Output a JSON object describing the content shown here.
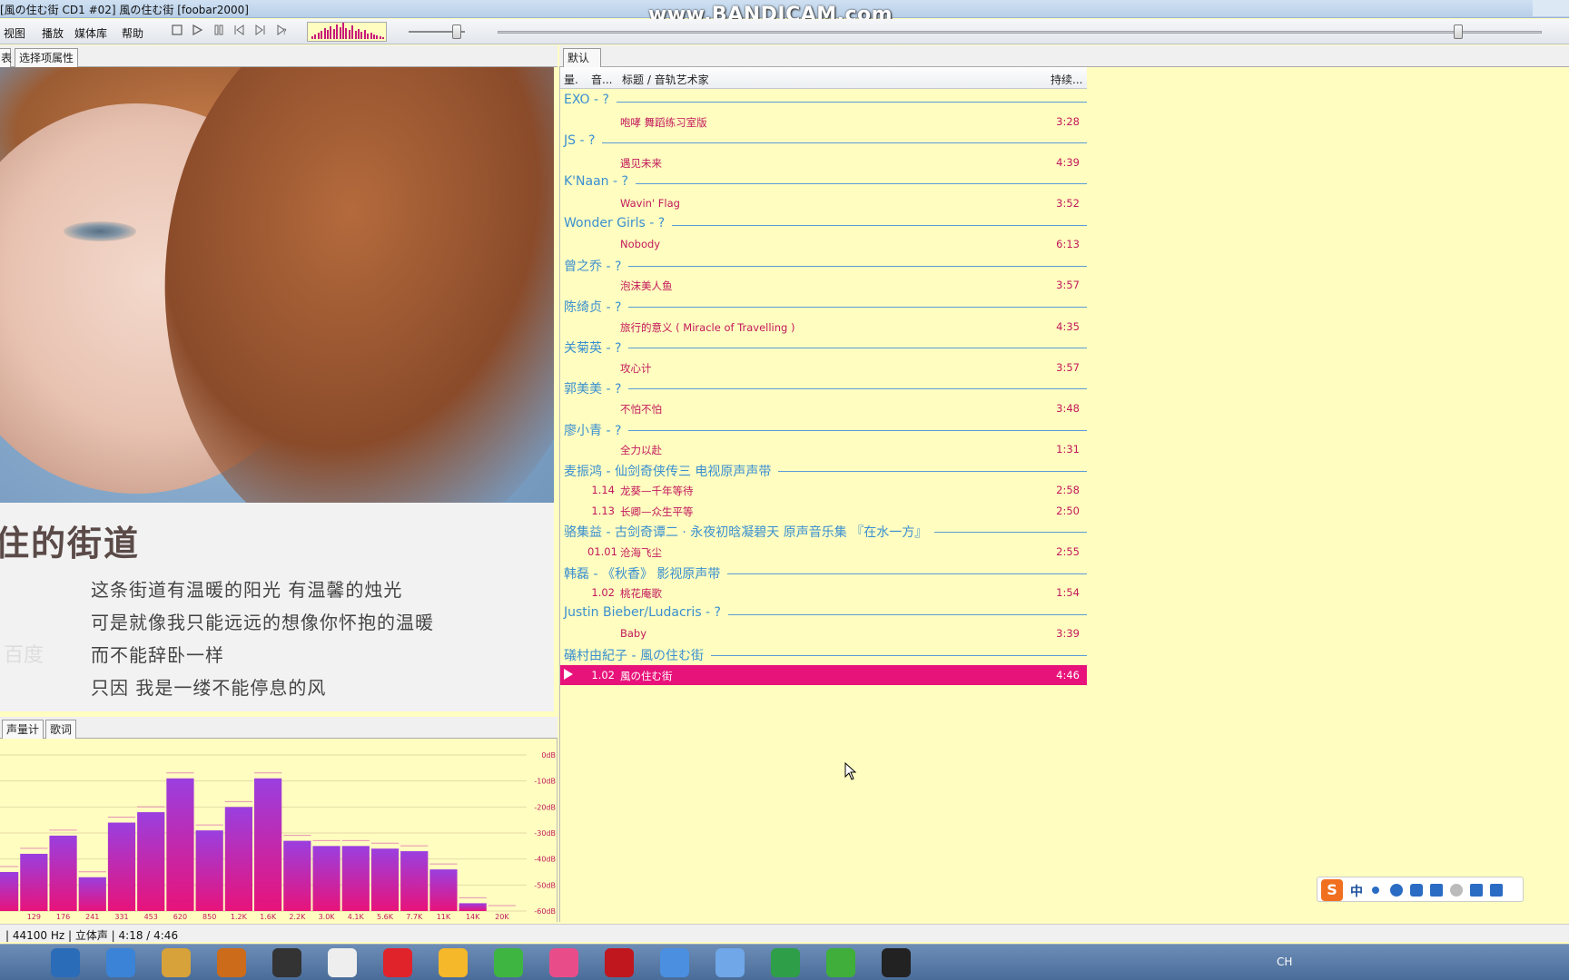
{
  "window": {
    "title": "[風の住む街 CD1 #02] 風の住む街  [foobar2000]",
    "watermark": "www.BANDICAM.com"
  },
  "menu": {
    "items": [
      "视图",
      "播放",
      "媒体库",
      "帮助"
    ]
  },
  "toolbar": {
    "buttons": [
      "stop-icon",
      "play-icon",
      "pause-icon",
      "prev-icon",
      "next-icon",
      "random-icon"
    ],
    "volume_level": 0.85,
    "seek_position": 0.92
  },
  "left_tabs": {
    "tab1": "表",
    "tab2": "选择项属性"
  },
  "lyrics": {
    "title": "住的街道",
    "lines": [
      "这条街道有温暖的阳光  有温馨的烛光",
      "可是就像我只能远远的想像你怀抱的温暖",
      "而不能辞卧一样",
      "只因  我是一缕不能停息的风"
    ],
    "logo": "百度"
  },
  "vis_tabs": {
    "tab1": "声量计",
    "tab2": "歌词"
  },
  "chart_data": {
    "type": "bar",
    "categories": [
      "",
      "129",
      "176",
      "241",
      "331",
      "453",
      "620",
      "850",
      "1.2K",
      "1.6K",
      "2.2K",
      "3.0K",
      "4.1K",
      "5.6K",
      "7.7K",
      "11K",
      "14K",
      "20K"
    ],
    "values": [
      -45,
      -38,
      -31,
      -47,
      -26,
      -22,
      -9,
      -29,
      -20,
      -9,
      -33,
      -35,
      -35,
      -36,
      -37,
      -44,
      -57,
      -60
    ],
    "ylim": [
      -60,
      0
    ],
    "yticks": [
      "0dB",
      "-10dB",
      "-20dB",
      "-30dB",
      "-40dB",
      "-50dB",
      "-60dB"
    ],
    "color_top": "#9a3fe0",
    "color_bottom": "#e8137a",
    "grid": true
  },
  "right_tabs": {
    "tab1": "默认"
  },
  "playlist": {
    "headers": {
      "col1": "量.",
      "col2": "音...",
      "col3": "标题 / 音轨艺术家",
      "col4": "持续..."
    },
    "groups": [
      {
        "label": "EXO - ?",
        "tracks": [
          {
            "num": "",
            "title": "咆哮 舞蹈练习室版",
            "dur": "3:28"
          }
        ]
      },
      {
        "label": "JS - ?",
        "tracks": [
          {
            "num": "",
            "title": "遇见未来",
            "dur": "4:39"
          }
        ]
      },
      {
        "label": "K'Naan - ?",
        "tracks": [
          {
            "num": "",
            "title": "Wavin' Flag",
            "dur": "3:52"
          }
        ]
      },
      {
        "label": "Wonder Girls - ?",
        "tracks": [
          {
            "num": "",
            "title": "Nobody",
            "dur": "6:13"
          }
        ]
      },
      {
        "label": "曾之乔 - ?",
        "tracks": [
          {
            "num": "",
            "title": "泡沫美人鱼",
            "dur": "3:57"
          }
        ]
      },
      {
        "label": "陈绮贞 - ?",
        "tracks": [
          {
            "num": "",
            "title": "旅行的意义 ( Miracle of Travelling )",
            "dur": "4:35"
          }
        ]
      },
      {
        "label": "关菊英 - ?",
        "tracks": [
          {
            "num": "",
            "title": "攻心计",
            "dur": "3:57"
          }
        ]
      },
      {
        "label": "郭美美 - ?",
        "tracks": [
          {
            "num": "",
            "title": "不怕不怕",
            "dur": "3:48"
          }
        ]
      },
      {
        "label": "廖小青 - ?",
        "tracks": [
          {
            "num": "",
            "title": "全力以赴",
            "dur": "1:31"
          }
        ]
      },
      {
        "label": "麦振鸿 - 仙剑奇侠传三 电视原声声带",
        "tracks": [
          {
            "num": "1.14",
            "title": "龙葵—千年等待",
            "dur": "2:58"
          },
          {
            "num": "1.13",
            "title": "长卿—众生平等",
            "dur": "2:50"
          }
        ]
      },
      {
        "label": "骆集益 - 古剑奇谭二 · 永夜初晗凝碧天 原声音乐集 『在水一方』",
        "tracks": [
          {
            "num": "01.01",
            "title": "沧海飞尘",
            "dur": "2:55"
          }
        ]
      },
      {
        "label": "韩磊 - 《秋香》 影视原声带",
        "tracks": [
          {
            "num": "1.02",
            "title": "桃花庵歌",
            "dur": "1:54"
          }
        ]
      },
      {
        "label": "Justin Bieber/Ludacris - ?",
        "tracks": [
          {
            "num": "",
            "title": "Baby",
            "dur": "3:39"
          }
        ]
      },
      {
        "label": "礒村由紀子 - 風の住む街",
        "tracks": [
          {
            "num": "1.02",
            "title": "風の住む街",
            "dur": "4:46",
            "playing": true
          }
        ]
      }
    ]
  },
  "status": {
    "text": "| 44100 Hz | 立体声 | 4:18 / 4:46"
  },
  "ime": {
    "logo": "S",
    "mode": "中"
  },
  "taskbar": {
    "apps": [
      "file-explorer-icon",
      "search-icon",
      "folder-icon",
      "321-player-icon",
      "headphones-icon",
      "foobar-icon",
      "netease-music-icon",
      "player-icon",
      "iqiyi-icon",
      "youku-icon",
      "flash-icon",
      "chrome-icon",
      "bird-icon",
      "media-player-icon",
      "360-browser-icon",
      "record-icon"
    ],
    "tray_lang": "CH"
  }
}
